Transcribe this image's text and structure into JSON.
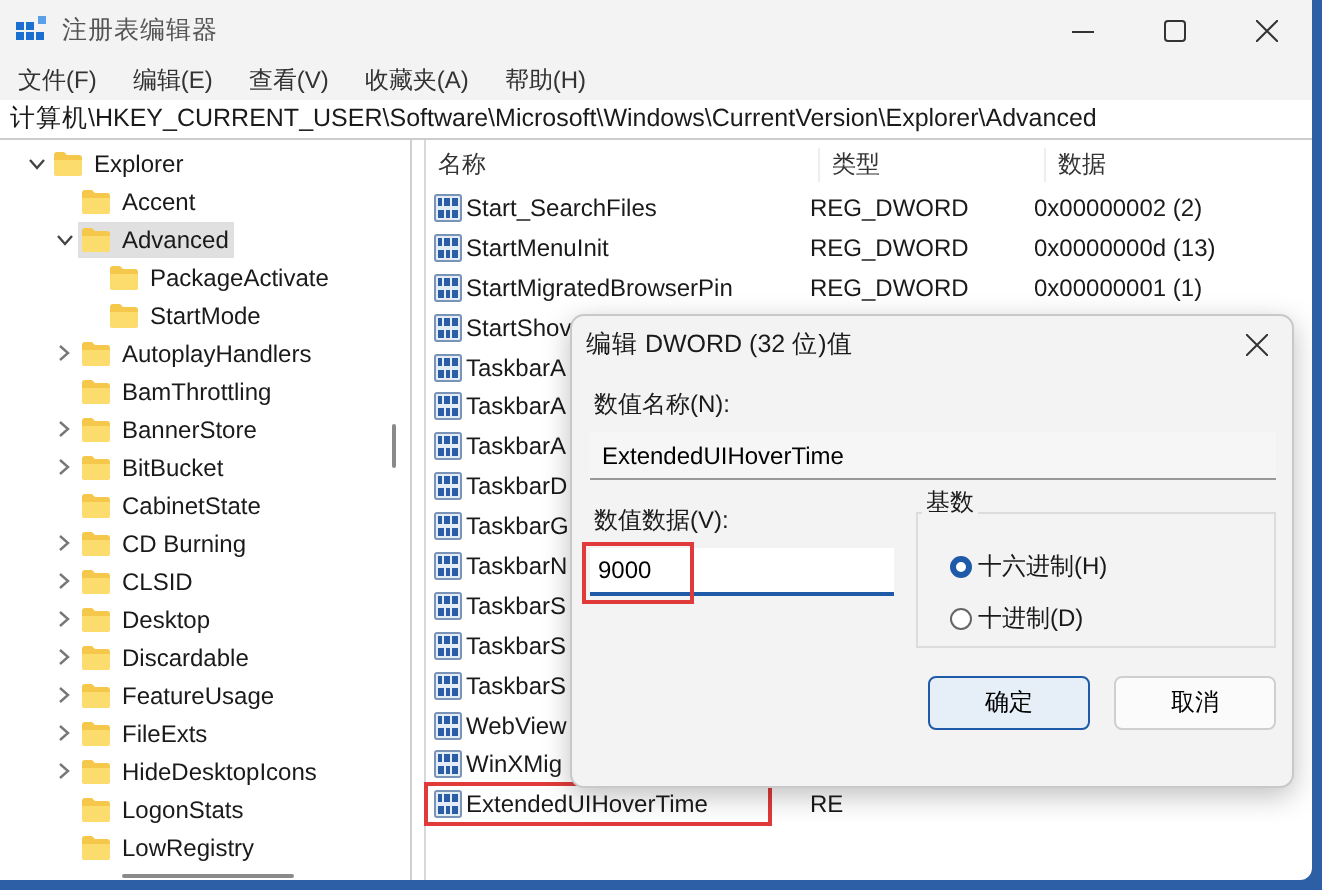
{
  "window": {
    "title": "注册表编辑器"
  },
  "menu": [
    "文件(F)",
    "编辑(E)",
    "查看(V)",
    "收藏夹(A)",
    "帮助(H)"
  ],
  "address": "计算机\\HKEY_CURRENT_USER\\Software\\Microsoft\\Windows\\CurrentVersion\\Explorer\\Advanced",
  "tree": {
    "items": [
      {
        "label": "Explorer",
        "expanded": true,
        "selected": false,
        "children": [
          {
            "label": "Accent",
            "selected": false
          },
          {
            "label": "Advanced",
            "expanded": true,
            "selected": true,
            "children": [
              {
                "label": "PackageActivate",
                "selected": false
              },
              {
                "label": "StartMode",
                "selected": false
              }
            ]
          },
          {
            "label": "AutoplayHandlers",
            "expanded": false,
            "selected": false
          },
          {
            "label": "BamThrottling",
            "selected": false
          },
          {
            "label": "BannerStore",
            "expanded": false,
            "selected": false
          },
          {
            "label": "BitBucket",
            "expanded": false,
            "selected": false
          },
          {
            "label": "CabinetState",
            "selected": false
          },
          {
            "label": "CD Burning",
            "expanded": false,
            "selected": false
          },
          {
            "label": "CLSID",
            "expanded": false,
            "selected": false
          },
          {
            "label": "Desktop",
            "expanded": false,
            "selected": false
          },
          {
            "label": "Discardable",
            "expanded": false,
            "selected": false
          },
          {
            "label": "FeatureUsage",
            "expanded": false,
            "selected": false
          },
          {
            "label": "FileExts",
            "expanded": false,
            "selected": false
          },
          {
            "label": "HideDesktopIcons",
            "expanded": false,
            "selected": false
          },
          {
            "label": "LogonStats",
            "selected": false
          },
          {
            "label": "LowRegistry",
            "selected": false
          }
        ]
      }
    ]
  },
  "list": {
    "columns": [
      "名称",
      "类型",
      "数据"
    ],
    "rows": [
      {
        "name": "Start_SearchFiles",
        "type": "REG_DWORD",
        "data": "0x00000002 (2)",
        "highlighted": false
      },
      {
        "name": "StartMenuInit",
        "type": "REG_DWORD",
        "data": "0x0000000d (13)",
        "highlighted": false
      },
      {
        "name": "StartMigratedBrowserPin",
        "type": "REG_DWORD",
        "data": "0x00000001 (1)",
        "highlighted": false
      },
      {
        "name": "StartShov",
        "highlighted": false
      },
      {
        "name": "TaskbarA",
        "highlighted": false
      },
      {
        "name": "TaskbarA",
        "highlighted": false
      },
      {
        "name": "TaskbarA",
        "highlighted": false
      },
      {
        "name": "TaskbarD",
        "highlighted": false
      },
      {
        "name": "TaskbarG",
        "highlighted": false
      },
      {
        "name": "TaskbarN",
        "highlighted": false
      },
      {
        "name": "TaskbarS",
        "highlighted": false
      },
      {
        "name": "TaskbarS",
        "highlighted": false
      },
      {
        "name": "TaskbarS",
        "highlighted": false
      },
      {
        "name": "WebView",
        "highlighted": false
      },
      {
        "name": "WinXMig",
        "highlighted": false
      },
      {
        "name": "ExtendedUIHoverTime",
        "type": "RE",
        "highlighted": true
      }
    ]
  },
  "dialog": {
    "title": "编辑 DWORD (32 位)值",
    "name_label": "数值名称(N):",
    "name_value": "ExtendedUIHoverTime",
    "data_label": "数值数据(V):",
    "data_value": "9000",
    "data_highlighted": true,
    "base_label": "基数",
    "bases": [
      {
        "label": "十六进制(H)",
        "selected": true
      },
      {
        "label": "十进制(D)",
        "selected": false
      }
    ],
    "buttons": [
      {
        "label": "确定",
        "default": true
      },
      {
        "label": "取消",
        "default": false
      }
    ]
  }
}
